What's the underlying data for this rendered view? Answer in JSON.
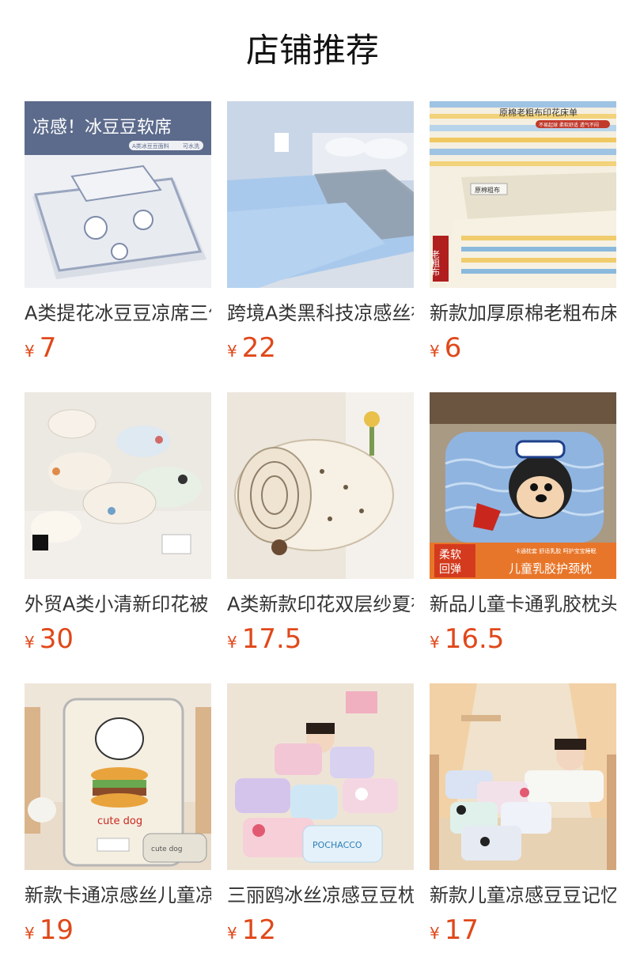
{
  "page": {
    "title": "店铺推荐"
  },
  "products": [
    {
      "name": "A类提花冰豆豆凉席三件套",
      "currency": "¥",
      "price": "7",
      "image_text": {
        "headline": "凉感！冰豆豆软席",
        "tag1": "A类冰豆豆面料",
        "tag2": "可水洗"
      }
    },
    {
      "name": "跨境A类黑科技凉感丝被",
      "currency": "¥",
      "price": "22"
    },
    {
      "name": "新款加厚原棉老粗布床单",
      "currency": "¥",
      "price": "6",
      "image_text": {
        "headline": "原棉老粗布印花床单",
        "sub": "不易起球 柔软舒适 透气不闷",
        "label": "原棉粗布",
        "seal": "老粗布"
      }
    },
    {
      "name": "外贸A类小清新印花被",
      "currency": "¥",
      "price": "30"
    },
    {
      "name": "A类新款印花双层纱夏被",
      "currency": "¥",
      "price": "17.5"
    },
    {
      "name": "新品儿童卡通乳胶枕头",
      "currency": "¥",
      "price": "16.5",
      "image_text": {
        "badge1": "柔软",
        "badge2": "回弹",
        "tagline": "卡通枕套 舒适乳胶 呵护宝宝睡眠",
        "banner": "儿童乳胶护颈枕"
      }
    },
    {
      "name": "新款卡通凉感丝儿童凉席",
      "currency": "¥",
      "price": "19",
      "image_text": {
        "mat": "cute dog",
        "pillow": "cute dog"
      }
    },
    {
      "name": "三丽鸥冰丝凉感豆豆枕",
      "currency": "¥",
      "price": "12",
      "image_text": {
        "pillow": "POCHACCO"
      }
    },
    {
      "name": "新款儿童凉感豆豆记忆枕",
      "currency": "¥",
      "price": "17"
    }
  ]
}
